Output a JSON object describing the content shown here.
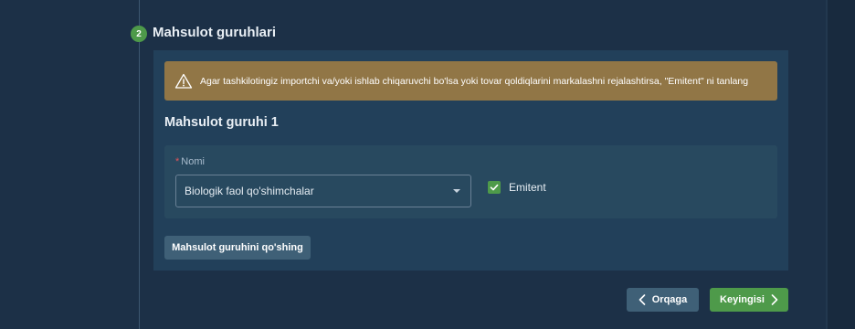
{
  "step": {
    "number": "2",
    "title": "Mahsulot guruhlari"
  },
  "warning": {
    "icon": "warning-triangle-icon",
    "text": "Agar tashkilotingiz importchi va/yoki ishlab chiqaruvchi bo'lsa yoki tovar qoldiqlarini markalashni rejalashtirsa, \"Emitent\" ni tanlang"
  },
  "group": {
    "title": "Mahsulot guruhi 1",
    "name_field": {
      "required_mark": "*",
      "label": "Nomi",
      "value": "Biologik faol qo'shimchalar"
    },
    "emitent": {
      "label": "Emitent",
      "checked": true
    }
  },
  "actions": {
    "add_group": "Mahsulot guruhini qo'shing",
    "back": "Orqaga",
    "next": "Keyingisi"
  },
  "colors": {
    "background": "#1c3047",
    "card": "#22405a",
    "warning": "#917646",
    "accent_green": "#4e9a4a",
    "secondary_button": "#3f6077"
  }
}
